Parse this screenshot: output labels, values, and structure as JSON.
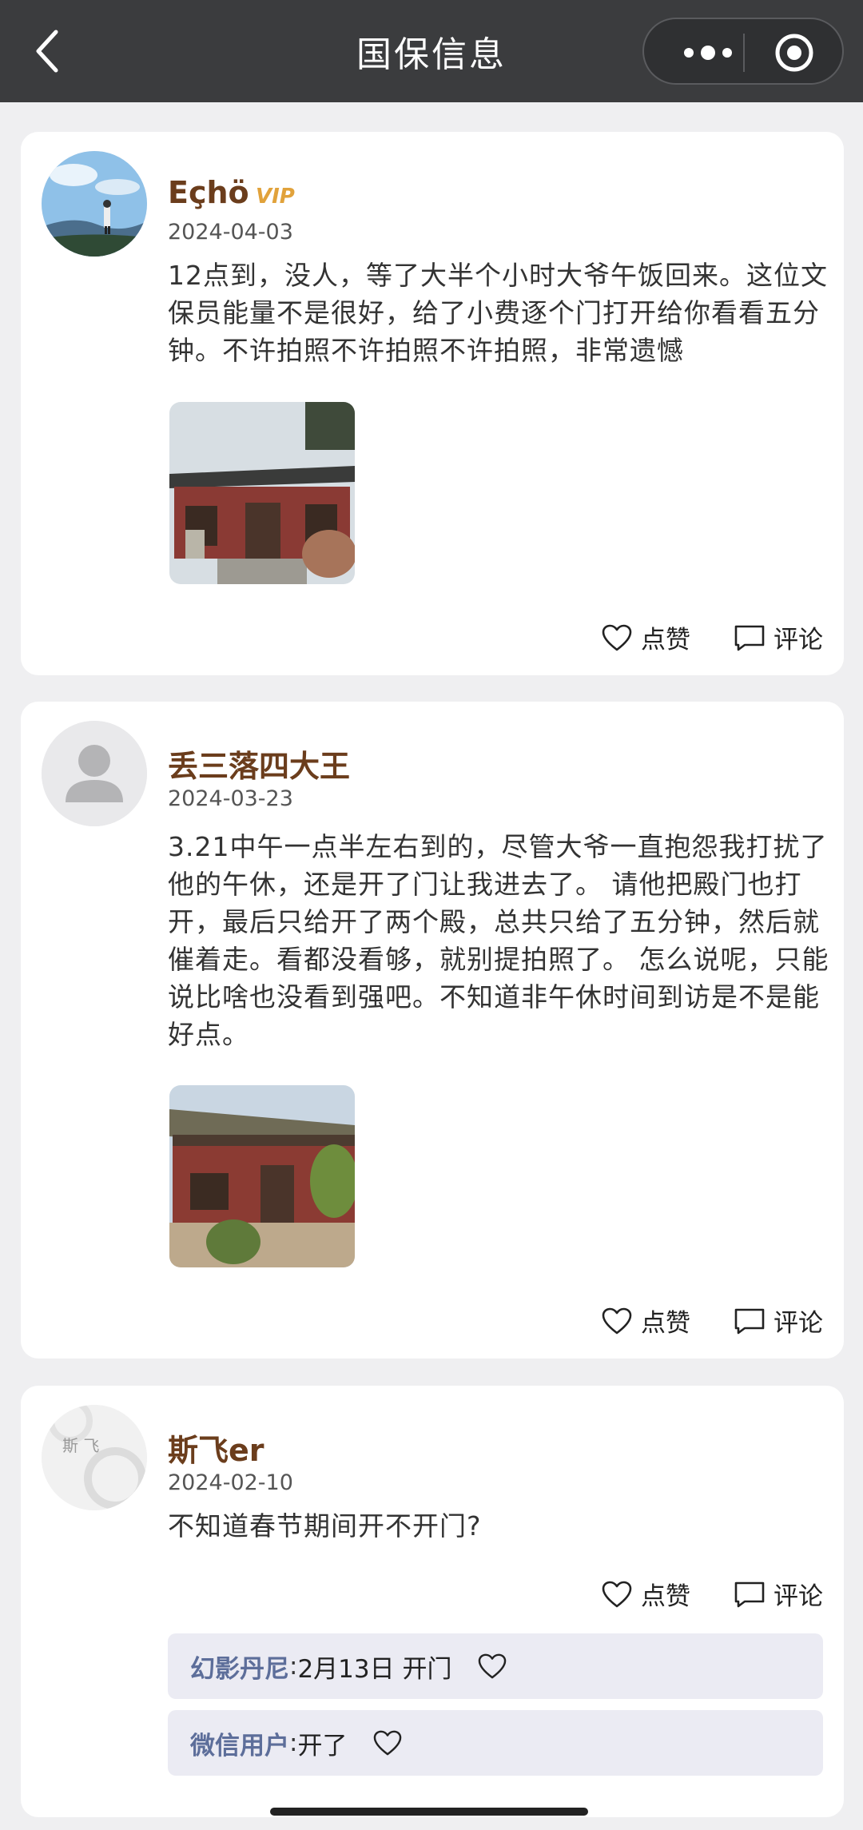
{
  "nav": {
    "title": "国保信息"
  },
  "posts": [
    {
      "username": "Eçhö",
      "vip": "VIP",
      "date": "2024-04-03",
      "content": "12点到，没人，等了大半个小时大爷午饭回来。这位文保员能量不是很好，给了小费逐个门打开给你看看五分钟。不许拍照不许拍照不许拍照，非常遗憾",
      "like_label": "点赞",
      "comment_label": "评论"
    },
    {
      "username": "丢三落四大王",
      "date": "2024-03-23",
      "content": "3.21中午一点半左右到的，尽管大爷一直抱怨我打扰了他的午休，还是开了门让我进去了。 请他把殿门也打开，最后只给开了两个殿，总共只给了五分钟，然后就催着走。看都没看够，就别提拍照了。 怎么说呢，只能说比啥也没看到强吧。不知道非午休时间到访是不是能好点。",
      "like_label": "点赞",
      "comment_label": "评论"
    },
    {
      "username": "斯飞er",
      "date": "2024-02-10",
      "content": "不知道春节期间开不开门?",
      "like_label": "点赞",
      "comment_label": "评论",
      "replies": [
        {
          "user": "幻影丹尼",
          "sep": ": ",
          "text": "2月13日 开门"
        },
        {
          "user": "微信用户",
          "sep": ": ",
          "text": "开了"
        }
      ]
    }
  ],
  "colors": {
    "username": "#6b3d1c",
    "reply_user": "#5d6e9a",
    "navbar": "#3b3c3e"
  }
}
